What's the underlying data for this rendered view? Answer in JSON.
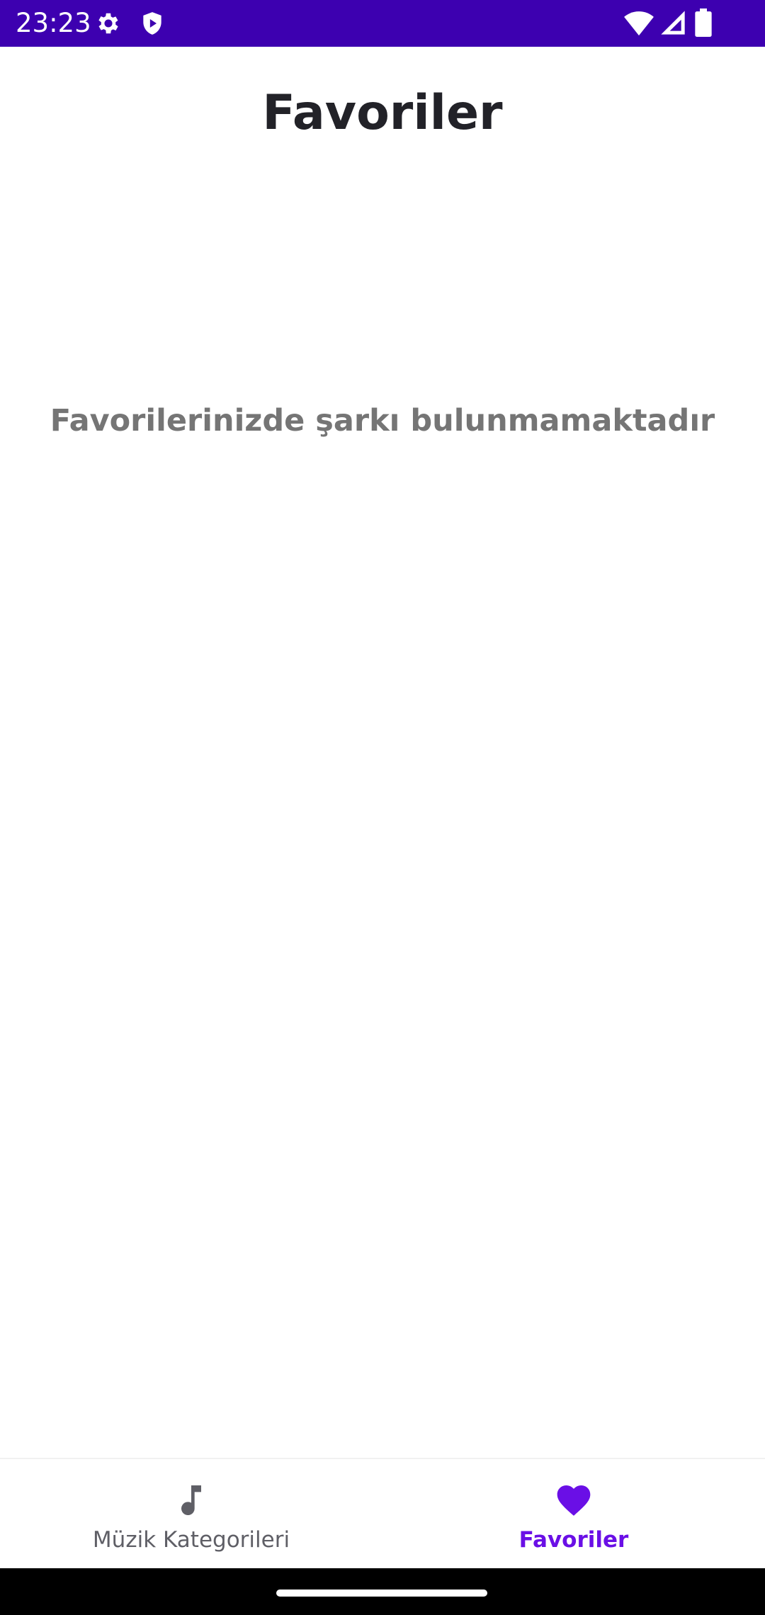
{
  "status_bar": {
    "time": "23:23",
    "background_color": "#3d00b0",
    "left_icons": [
      "gear-icon",
      "shield-play-icon"
    ],
    "right_icons": [
      "wifi-icon",
      "signal-icon",
      "battery-icon"
    ]
  },
  "page": {
    "title": "Favoriler",
    "empty_message": "Favorilerinizde şarkı bulunmamaktadır"
  },
  "bottom_nav": {
    "items": [
      {
        "label": "Müzik Kategorileri",
        "icon": "music-note-icon",
        "active": false
      },
      {
        "label": "Favoriler",
        "icon": "heart-icon",
        "active": true
      }
    ],
    "active_color": "#6a0fe6",
    "inactive_color": "#5f5f66"
  }
}
